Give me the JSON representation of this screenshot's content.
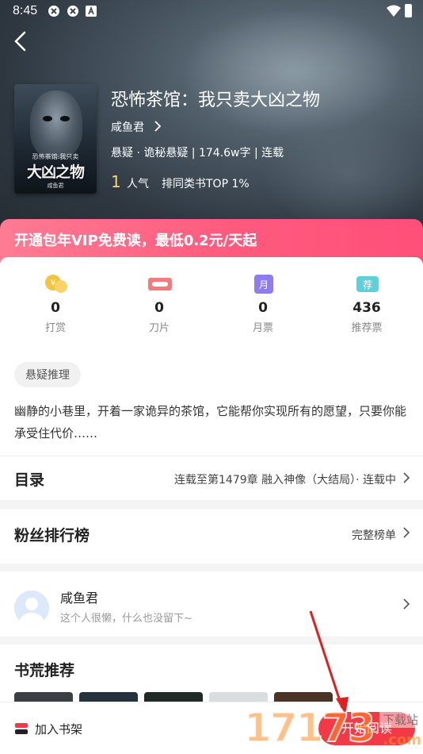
{
  "statusbar": {
    "time": "8:45"
  },
  "book": {
    "title": "恐怖茶馆：我只卖大凶之物",
    "author": "咸鱼君",
    "meta": "悬疑 · 诡秘悬疑 | 174.6w字 | 连载",
    "popularity_value": "1",
    "popularity_label": "人气",
    "rank_text": "排同类书TOP 1%",
    "cover": {
      "title_small": "恐怖茶馆:我只卖",
      "title_big": "大凶之物",
      "author": "咸鱼君"
    }
  },
  "vip_banner": {
    "text": "开通包年VIP免费读，最低0.2元/天起"
  },
  "stats": [
    {
      "icon": "coin-icon",
      "value": "0",
      "label": "打赏"
    },
    {
      "icon": "blade-icon",
      "value": "0",
      "label": "刀片"
    },
    {
      "icon": "monthly-ticket-icon",
      "value": "0",
      "label": "月票"
    },
    {
      "icon": "recommend-ticket-icon",
      "value": "436",
      "label": "推荐票"
    }
  ],
  "intro": {
    "tag": "悬疑推理",
    "description": "幽静的小巷里，开着一家诡异的茶馆，它能帮你实现所有的愿望，只要你能承受住代价……"
  },
  "catalog": {
    "title": "目录",
    "status": "连载至第1479章 融入神像（大结局）· 连载中"
  },
  "fans": {
    "title": "粉丝排行榜",
    "link": "完整榜单"
  },
  "author_card": {
    "name": "咸鱼君",
    "bio": "这个人很懒，什么也没留下~"
  },
  "recommend": {
    "title": "书荒推荐"
  },
  "bottom": {
    "shelf_label": "加入书架",
    "read_label": "开始阅读"
  },
  "watermark": {
    "number": "17173",
    "download_text": "下载站",
    "domain": ".com"
  },
  "colors": {
    "vip_gradient_start": "#ff7b93",
    "vip_gradient_end": "#ff4f7a",
    "read_button": "#f23a47",
    "popularity": "#f7d774"
  }
}
